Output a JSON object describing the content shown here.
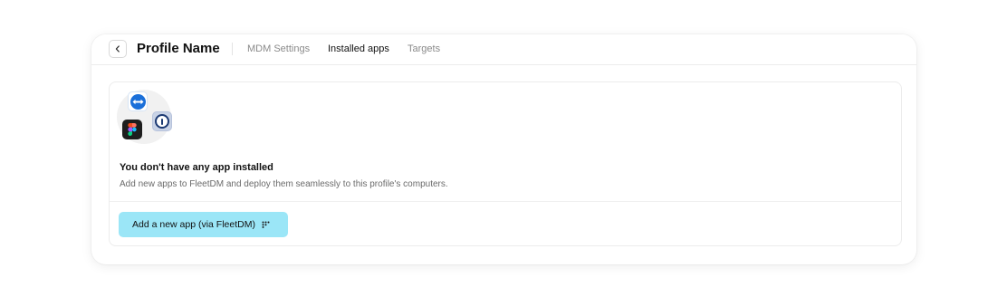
{
  "header": {
    "back_icon": "chevron-left-icon",
    "title": "Profile Name",
    "tabs": [
      {
        "label": "MDM Settings",
        "active": false
      },
      {
        "label": "Installed apps",
        "active": true
      },
      {
        "label": "Targets",
        "active": false
      }
    ]
  },
  "empty_state": {
    "icons": [
      "teamviewer-icon",
      "figma-icon",
      "1password-icon"
    ],
    "title": "You don't have any app installed",
    "description": "Add new apps to FleetDM and deploy them seamlessly to this profile's computers.",
    "button_label": "Add a new app (via FleetDM)",
    "button_icon": "fleetdm-logo-icon",
    "button_color": "#9be6f7"
  }
}
